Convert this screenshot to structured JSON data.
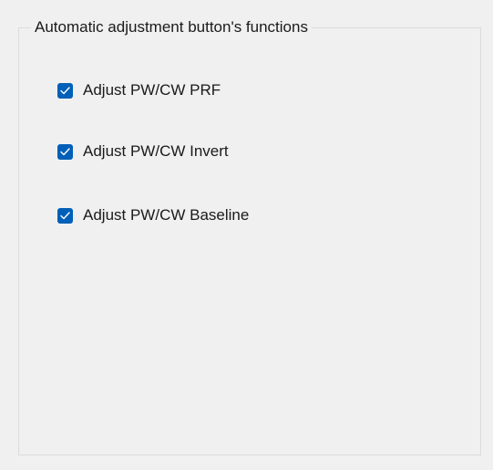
{
  "group": {
    "title": "Automatic adjustment button's functions"
  },
  "options": [
    {
      "label": "Adjust PW/CW PRF",
      "checked": true
    },
    {
      "label": "Adjust PW/CW Invert",
      "checked": true
    },
    {
      "label": "Adjust PW/CW Baseline",
      "checked": true
    }
  ],
  "colors": {
    "checkbox_fill": "#005fb8",
    "background": "#f0f0f0",
    "border": "#dcdcdc"
  }
}
